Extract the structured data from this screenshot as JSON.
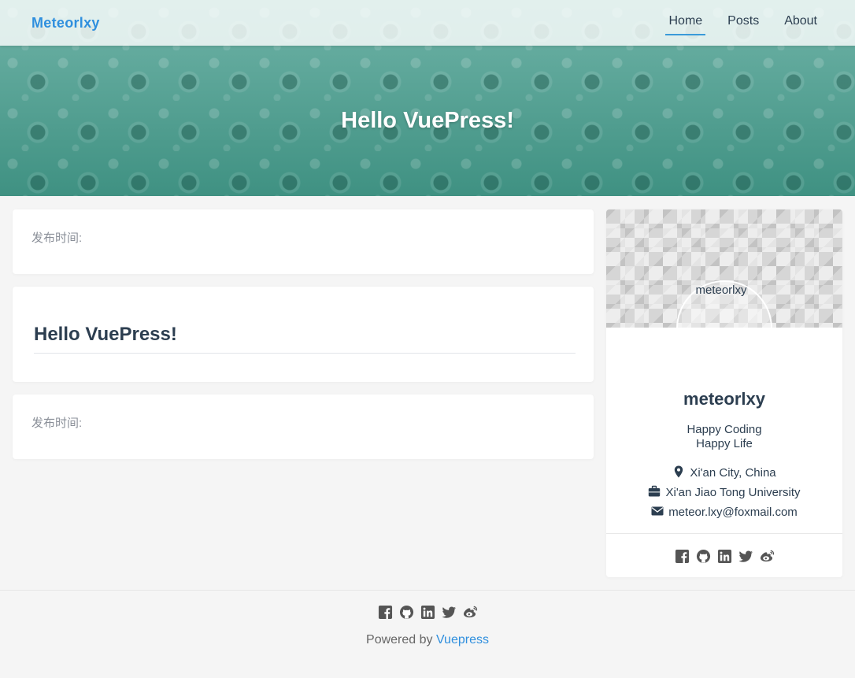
{
  "navbar": {
    "brand": "Meteorlxy",
    "links": [
      {
        "label": "Home",
        "active": true
      },
      {
        "label": "Posts",
        "active": false
      },
      {
        "label": "About",
        "active": false
      }
    ]
  },
  "hero": {
    "title": "Hello VuePress!"
  },
  "posts": {
    "meta_label_top": "发布时间:",
    "title": "Hello VuePress!",
    "meta_label_bottom": "发布时间:"
  },
  "profile": {
    "avatar_alt": "meteorlxy",
    "name": "meteorlxy",
    "bio_line1": "Happy Coding",
    "bio_line2": "Happy Life",
    "location": "Xi'an City, China",
    "organization": "Xi'an Jiao Tong University",
    "email": "meteor.lxy@foxmail.com",
    "social_icons": [
      "facebook-icon",
      "github-icon",
      "linkedin-icon",
      "twitter-icon",
      "weibo-icon"
    ]
  },
  "footer": {
    "powered_prefix": "Powered by",
    "powered_link": "Vuepress",
    "social_icons": [
      "facebook-icon",
      "github-icon",
      "linkedin-icon",
      "twitter-icon",
      "weibo-icon"
    ]
  },
  "colors": {
    "accent": "#2f8fde",
    "hero_green": "#4a9a8c",
    "text": "#2c3e50",
    "meta_gray": "#8a8f98",
    "icon_gray": "#555555"
  }
}
